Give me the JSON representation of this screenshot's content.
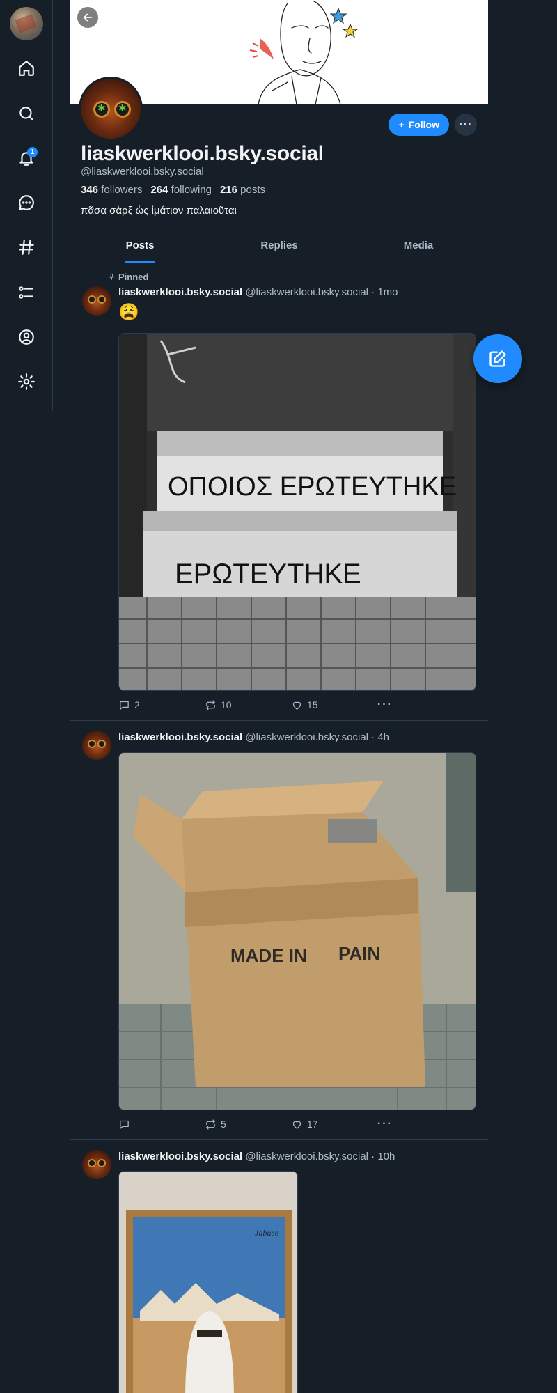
{
  "nav": {
    "items": [
      {
        "name": "home-icon"
      },
      {
        "name": "search-icon"
      },
      {
        "name": "bell-icon",
        "badge": "1"
      },
      {
        "name": "chat-icon"
      },
      {
        "name": "hashtag-icon"
      },
      {
        "name": "list-icon"
      },
      {
        "name": "profile-icon"
      },
      {
        "name": "gear-icon"
      }
    ]
  },
  "profile": {
    "display_name": "liaskwerklooi.bsky.social",
    "handle": "@liaskwerklooi.bsky.social",
    "followers_count": "346",
    "followers_label": "followers",
    "following_count": "264",
    "following_label": "following",
    "posts_count": "216",
    "posts_label": "posts",
    "bio": "πᾶσα σὰρξ ὡς ἱμάτιον παλαιοῦται",
    "follow_label": "Follow",
    "more_label": "···"
  },
  "tabs": [
    {
      "label": "Posts",
      "active": true
    },
    {
      "label": "Replies",
      "active": false
    },
    {
      "label": "Media",
      "active": false
    }
  ],
  "posts": [
    {
      "pinned_label": "Pinned",
      "author": "liaskwerklooi.bsky.social",
      "meta": "@liaskwerklooi.bsky.social · 1mo",
      "emoji": "😩",
      "image_text": [
        "ΟΠΟΙΟΣ ΕΡΩΤΕΥΤΗΚΕ",
        "ΕΡΩΤΕΥΤΗΚΕ"
      ],
      "replies": "2",
      "reposts": "10",
      "likes": "15"
    },
    {
      "author": "liaskwerklooi.bsky.social",
      "meta": "@liaskwerklooi.bsky.social · 4h",
      "image_text": [
        "MADE IN",
        "PAIN"
      ],
      "replies": "",
      "reposts": "5",
      "likes": "17"
    },
    {
      "author": "liaskwerklooi.bsky.social",
      "meta": "@liaskwerklooi.bsky.social · 10h"
    }
  ],
  "colors": {
    "background": "#161e27",
    "accent": "#208bfe",
    "border": "#2c3a4b",
    "muted_text": "#aebbc9"
  }
}
